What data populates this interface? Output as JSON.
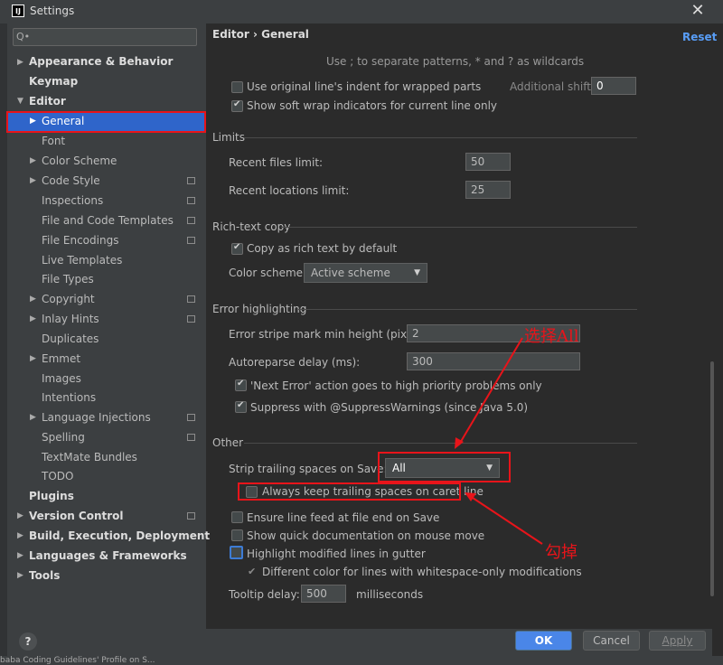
{
  "window": {
    "title": "Settings",
    "app_icon_text": "IJ"
  },
  "search": {
    "placeholder": "Q•"
  },
  "sidebar": {
    "items": [
      {
        "label": "Appearance & Behavior"
      },
      {
        "label": "Keymap"
      },
      {
        "label": "Editor"
      },
      {
        "label": "General"
      },
      {
        "label": "Font"
      },
      {
        "label": "Color Scheme"
      },
      {
        "label": "Code Style"
      },
      {
        "label": "Inspections"
      },
      {
        "label": "File and Code Templates"
      },
      {
        "label": "File Encodings"
      },
      {
        "label": "Live Templates"
      },
      {
        "label": "File Types"
      },
      {
        "label": "Copyright"
      },
      {
        "label": "Inlay Hints"
      },
      {
        "label": "Duplicates"
      },
      {
        "label": "Emmet"
      },
      {
        "label": "Images"
      },
      {
        "label": "Intentions"
      },
      {
        "label": "Language Injections"
      },
      {
        "label": "Spelling"
      },
      {
        "label": "TextMate Bundles"
      },
      {
        "label": "TODO"
      },
      {
        "label": "Plugins"
      },
      {
        "label": "Version Control"
      },
      {
        "label": "Build, Execution, Deployment"
      },
      {
        "label": "Languages & Frameworks"
      },
      {
        "label": "Tools"
      }
    ]
  },
  "header": {
    "breadcrumb": "Editor  ›  General",
    "reset": "Reset"
  },
  "main": {
    "hint": "Use ; to separate patterns, * and ? as wildcards",
    "use_indent": "Use original line's indent for wrapped parts",
    "additional_shift_label": "Additional shift:",
    "additional_shift_value": "0",
    "soft_wrap_indicators": "Show soft wrap indicators for current line only",
    "limits_title": "Limits",
    "recent_files_label": "Recent files limit:",
    "recent_files_value": "50",
    "recent_locations_label": "Recent locations limit:",
    "recent_locations_value": "25",
    "rich_text_title": "Rich-text copy",
    "copy_rich": "Copy as rich text by default",
    "color_scheme_label": "Color scheme:",
    "color_scheme_value": "Active scheme",
    "error_title": "Error highlighting",
    "stripe_label": "Error stripe mark min height (pixels):",
    "stripe_value": "2",
    "autoreparse_label": "Autoreparse delay (ms):",
    "autoreparse_value": "300",
    "next_error": "'Next Error' action goes to high priority problems only",
    "suppress": "Suppress with @SuppressWarnings (since Java 5.0)",
    "other_title": "Other",
    "strip_label": "Strip trailing spaces on Save:",
    "strip_value": "All",
    "keep_trailing": "Always keep trailing spaces on caret line",
    "line_feed": "Ensure line feed at file end on Save",
    "quick_doc": "Show quick documentation on mouse move",
    "highlight_modified": "Highlight modified lines in gutter",
    "different_color": "Different color for lines with whitespace-only modifications",
    "tooltip_label": "Tooltip delay:",
    "tooltip_value": "500",
    "tooltip_unit": "milliseconds"
  },
  "annotations": {
    "select_all": "选择All",
    "uncheck": "勾掉"
  },
  "buttons": {
    "ok": "OK",
    "cancel": "Cancel",
    "apply": "Apply",
    "help": "?"
  },
  "statusbar": {
    "text": "baba Coding Guidelines' Profile on S..."
  },
  "colors": {
    "accent": "#4a86e8",
    "selection": "#2f65ca",
    "annotation": "#e8141a"
  }
}
